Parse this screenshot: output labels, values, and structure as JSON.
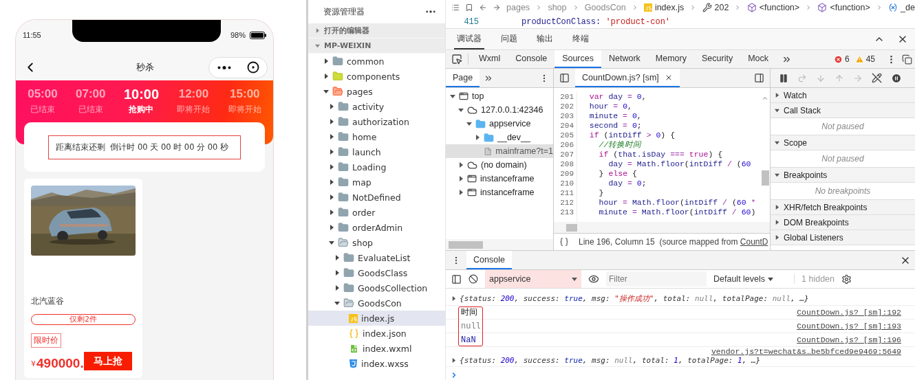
{
  "phone": {
    "status_time": "11:55",
    "battery": "98%",
    "title": "秒杀",
    "slots": [
      {
        "time": "05:00",
        "label": "已结束",
        "selected": false
      },
      {
        "time": "07:00",
        "label": "已结束",
        "selected": false
      },
      {
        "time": "10:00",
        "label": "抢购中",
        "selected": true
      },
      {
        "time": "12:00",
        "label": "即将开始",
        "selected": false
      },
      {
        "time": "15:00",
        "label": "即将开始",
        "selected": false
      }
    ],
    "countdown": "距离结束还剩  倒计时 00 天 00 时 00 分 00 秒",
    "products": [
      {
        "name": "北汽蓝谷",
        "stock": "仅剩2件",
        "tag": "限时价",
        "currency": "¥",
        "price": "490000.",
        "button": "马上抢"
      }
    ]
  },
  "explorer": {
    "title": "资源管理器",
    "sections": [
      {
        "label": "打开的编辑器",
        "expanded": false
      },
      {
        "label": "MP-WEIXIN",
        "expanded": true
      }
    ],
    "tree": [
      {
        "label": "common",
        "kind": "folder",
        "expanded": false,
        "selected": false
      },
      {
        "label": "components",
        "kind": "lib",
        "expanded": false,
        "selected": false
      },
      {
        "label": "pages",
        "kind": "pages",
        "expanded": true,
        "selected": false,
        "children": [
          {
            "label": "activity",
            "kind": "folder",
            "expanded": false,
            "selected": false
          },
          {
            "label": "authorization",
            "kind": "folder",
            "expanded": false,
            "selected": false
          },
          {
            "label": "home",
            "kind": "folder",
            "expanded": false,
            "selected": false
          },
          {
            "label": "launch",
            "kind": "folder",
            "expanded": false,
            "selected": false
          },
          {
            "label": "Loading",
            "kind": "folder",
            "expanded": false,
            "selected": false
          },
          {
            "label": "map",
            "kind": "folder",
            "expanded": false,
            "selected": false
          },
          {
            "label": "NotDefined",
            "kind": "folder",
            "expanded": false,
            "selected": false
          },
          {
            "label": "order",
            "kind": "folder",
            "expanded": false,
            "selected": false
          },
          {
            "label": "orderAdmin",
            "kind": "folder",
            "expanded": false,
            "selected": false
          },
          {
            "label": "shop",
            "kind": "folder",
            "expanded": true,
            "selected": false,
            "children": [
              {
                "label": "EvaluateList",
                "kind": "folder",
                "expanded": false,
                "selected": false
              },
              {
                "label": "GoodsClass",
                "kind": "folder",
                "expanded": false,
                "selected": false
              },
              {
                "label": "GoodsCollection",
                "kind": "folder",
                "expanded": false,
                "selected": false
              },
              {
                "label": "GoodsCon",
                "kind": "folder",
                "expanded": true,
                "selected": false,
                "children": [
                  {
                    "label": "index.js",
                    "kind": "js",
                    "selected": true
                  },
                  {
                    "label": "index.json",
                    "kind": "json",
                    "selected": false
                  },
                  {
                    "label": "index.wxml",
                    "kind": "wxml",
                    "selected": false
                  },
                  {
                    "label": "index.wxss",
                    "kind": "wxss",
                    "selected": false
                  }
                ]
              }
            ]
          }
        ]
      }
    ]
  },
  "breadcrumb": [
    {
      "label": "pages",
      "kind": "text"
    },
    {
      "label": "shop",
      "kind": "text"
    },
    {
      "label": "GoodsCon",
      "kind": "text"
    },
    {
      "label": "index.js",
      "kind": "js"
    },
    {
      "label": "202",
      "kind": "wrench"
    },
    {
      "label": "<function>",
      "kind": "cube"
    },
    {
      "label": "<function>",
      "kind": "cube"
    },
    {
      "label": "_de",
      "kind": "variable"
    }
  ],
  "peek_line": {
    "number": "415",
    "tokens": [
      {
        "text": "productConClass: ",
        "kind": "id"
      },
      {
        "text": "'product-con'",
        "kind": "str"
      }
    ]
  },
  "panel_tabs": [
    {
      "label": "调试器",
      "selected": true
    },
    {
      "label": "问题",
      "selected": false
    },
    {
      "label": "输出",
      "selected": false
    },
    {
      "label": "终端",
      "selected": false
    }
  ],
  "tool_tabs": [
    {
      "label": "Wxml",
      "selected": false
    },
    {
      "label": "Console",
      "selected": false
    },
    {
      "label": "Sources",
      "selected": true
    },
    {
      "label": "Network",
      "selected": false
    },
    {
      "label": "Memory",
      "selected": false
    },
    {
      "label": "Security",
      "selected": false
    },
    {
      "label": "Mock",
      "selected": false
    }
  ],
  "errors": "6",
  "warnings": "45",
  "navigator": {
    "tab": "Page",
    "tree": [
      {
        "label": "top",
        "kind": "frame",
        "expanded": true,
        "selected": false,
        "children": [
          {
            "label": "127.0.0.1:42346",
            "kind": "cloud",
            "expanded": true,
            "selected": false,
            "children": [
              {
                "label": "appservice",
                "kind": "folder",
                "expanded": true,
                "selected": false,
                "children": [
                  {
                    "label": "__dev__",
                    "kind": "folder",
                    "expanded": false,
                    "selected": false
                  },
                  {
                    "label": "mainframe?t=1",
                    "kind": "file",
                    "selected": true
                  }
                ]
              }
            ]
          },
          {
            "label": "(no domain)",
            "kind": "cloud",
            "expanded": false,
            "selected": false
          },
          {
            "label": "instanceframe",
            "kind": "frame",
            "expanded": false,
            "selected": false
          },
          {
            "label": "instanceframe",
            "kind": "frame",
            "expanded": false,
            "selected": false
          }
        ]
      }
    ]
  },
  "editor": {
    "tab": "CountDown.js? [sm]",
    "lines": [
      {
        "n": "201",
        "tokens": [
          {
            "text": "  var ",
            "kind": "kw"
          },
          {
            "text": "day",
            "kind": "id"
          },
          {
            "text": " = ",
            "kind": "op"
          },
          {
            "text": "0",
            "kind": "num"
          },
          {
            "text": ",",
            "kind": "pl"
          }
        ]
      },
      {
        "n": "202",
        "tokens": [
          {
            "text": "  hour",
            "kind": "id"
          },
          {
            "text": " = ",
            "kind": "op"
          },
          {
            "text": "0",
            "kind": "num"
          },
          {
            "text": ",",
            "kind": "pl"
          }
        ]
      },
      {
        "n": "203",
        "tokens": [
          {
            "text": "  minute",
            "kind": "id"
          },
          {
            "text": " = ",
            "kind": "op"
          },
          {
            "text": "0",
            "kind": "num"
          },
          {
            "text": ",",
            "kind": "pl"
          }
        ]
      },
      {
        "n": "204",
        "tokens": [
          {
            "text": "  second",
            "kind": "id"
          },
          {
            "text": " = ",
            "kind": "op"
          },
          {
            "text": "0",
            "kind": "num"
          },
          {
            "text": ";",
            "kind": "pl"
          }
        ]
      },
      {
        "n": "205",
        "tokens": [
          {
            "text": "  if",
            "kind": "kw"
          },
          {
            "text": " (",
            "kind": "pl"
          },
          {
            "text": "intDiff",
            "kind": "id"
          },
          {
            "text": " > ",
            "kind": "op"
          },
          {
            "text": "0",
            "kind": "num"
          },
          {
            "text": ") {",
            "kind": "pl"
          }
        ]
      },
      {
        "n": "206",
        "tokens": [
          {
            "text": "    //转换时间",
            "kind": "cmt"
          }
        ]
      },
      {
        "n": "207",
        "tokens": [
          {
            "text": "    if",
            "kind": "kw"
          },
          {
            "text": " (",
            "kind": "pl"
          },
          {
            "text": "that.isDay",
            "kind": "id"
          },
          {
            "text": " === ",
            "kind": "op"
          },
          {
            "text": "true",
            "kind": "kw"
          },
          {
            "text": ") {",
            "kind": "pl"
          }
        ]
      },
      {
        "n": "208",
        "tokens": [
          {
            "text": "      day",
            "kind": "id"
          },
          {
            "text": " = ",
            "kind": "op"
          },
          {
            "text": "Math.floor",
            "kind": "id"
          },
          {
            "text": "(",
            "kind": "pl"
          },
          {
            "text": "intDiff",
            "kind": "id"
          },
          {
            "text": " / ",
            "kind": "op"
          },
          {
            "text": "(",
            "kind": "pl"
          },
          {
            "text": "60",
            "kind": "num"
          }
        ]
      },
      {
        "n": "209",
        "tokens": [
          {
            "text": "    } ",
            "kind": "pl"
          },
          {
            "text": "else",
            "kind": "kw"
          },
          {
            "text": " {",
            "kind": "pl"
          }
        ]
      },
      {
        "n": "210",
        "tokens": [
          {
            "text": "      day",
            "kind": "id"
          },
          {
            "text": " = ",
            "kind": "op"
          },
          {
            "text": "0",
            "kind": "num"
          },
          {
            "text": ";",
            "kind": "pl"
          }
        ]
      },
      {
        "n": "211",
        "tokens": [
          {
            "text": "    }",
            "kind": "pl"
          }
        ]
      },
      {
        "n": "212",
        "tokens": [
          {
            "text": "    hour",
            "kind": "id"
          },
          {
            "text": " = ",
            "kind": "op"
          },
          {
            "text": "Math.floor",
            "kind": "id"
          },
          {
            "text": "(",
            "kind": "pl"
          },
          {
            "text": "intDiff",
            "kind": "id"
          },
          {
            "text": " / ",
            "kind": "op"
          },
          {
            "text": "(",
            "kind": "pl"
          },
          {
            "text": "60",
            "kind": "num"
          },
          {
            "text": " *",
            "kind": "op"
          }
        ]
      },
      {
        "n": "213",
        "tokens": [
          {
            "text": "    minute",
            "kind": "id"
          },
          {
            "text": " = ",
            "kind": "op"
          },
          {
            "text": "Math.floor",
            "kind": "id"
          },
          {
            "text": "(",
            "kind": "pl"
          },
          {
            "text": "intDiff",
            "kind": "id"
          },
          {
            "text": " / ",
            "kind": "op"
          },
          {
            "text": "60",
            "kind": "num"
          },
          {
            "text": ")",
            "kind": "pl"
          }
        ]
      }
    ],
    "status": "Line 196, Column 15  (source mapped from ",
    "status_link": "CountD"
  },
  "debugger": [
    {
      "label": "Watch",
      "expanded": false
    },
    {
      "label": "Call Stack",
      "expanded": true,
      "content": "Not paused"
    },
    {
      "label": "Scope",
      "expanded": true,
      "content": "Not paused"
    },
    {
      "label": "Breakpoints",
      "expanded": true,
      "content": "No breakpoints"
    },
    {
      "label": "XHR/fetch Breakpoints",
      "expanded": false
    },
    {
      "label": "DOM Breakpoints",
      "expanded": false
    },
    {
      "label": "Global Listeners",
      "expanded": false
    }
  ],
  "console": {
    "tab": "Console",
    "context": "appservice",
    "filter_placeholder": "Filter",
    "levels": "Default levels",
    "hidden": "1 hidden",
    "messages": [
      {
        "kind": "object",
        "highlighted": false,
        "tokens": [
          {
            "text": "{",
            "kind": "pl"
          },
          {
            "text": "status",
            "kind": "key"
          },
          {
            "text": ": ",
            "kind": "pl"
          },
          {
            "text": "200",
            "kind": "num"
          },
          {
            "text": ", ",
            "kind": "pl"
          },
          {
            "text": "success",
            "kind": "key"
          },
          {
            "text": ": ",
            "kind": "pl"
          },
          {
            "text": "true",
            "kind": "bool"
          },
          {
            "text": ", ",
            "kind": "pl"
          },
          {
            "text": "msg",
            "kind": "key"
          },
          {
            "text": ": ",
            "kind": "pl"
          },
          {
            "text": "\"操作成功\"",
            "kind": "str"
          },
          {
            "text": ", ",
            "kind": "pl"
          },
          {
            "text": "total",
            "kind": "key"
          },
          {
            "text": ": ",
            "kind": "pl"
          },
          {
            "text": "null",
            "kind": "nul"
          },
          {
            "text": ", ",
            "kind": "pl"
          },
          {
            "text": "totalPage",
            "kind": "key"
          },
          {
            "text": ": ",
            "kind": "pl"
          },
          {
            "text": "null",
            "kind": "nul"
          },
          {
            "text": ", …}",
            "kind": "pl"
          }
        ]
      },
      {
        "kind": "text",
        "highlighted": true,
        "text": "时间",
        "source": "CountDown.js? [sm]:192"
      },
      {
        "kind": "null",
        "highlighted": true,
        "text": "null",
        "source": "CountDown.js? [sm]:193"
      },
      {
        "kind": "number",
        "highlighted": true,
        "text": "NaN",
        "source": "CountDown.js? [sm]:196"
      },
      {
        "kind": "object",
        "highlighted": false,
        "source": "vendor.js?t=wechat&s…be5bfced9e9469:5649",
        "tokens": [
          {
            "text": "{",
            "kind": "pl"
          },
          {
            "text": "status",
            "kind": "key"
          },
          {
            "text": ": ",
            "kind": "pl"
          },
          {
            "text": "200",
            "kind": "num"
          },
          {
            "text": ", ",
            "kind": "pl"
          },
          {
            "text": "success",
            "kind": "key"
          },
          {
            "text": ": ",
            "kind": "pl"
          },
          {
            "text": "true",
            "kind": "bool"
          },
          {
            "text": ", ",
            "kind": "pl"
          },
          {
            "text": "msg",
            "kind": "key"
          },
          {
            "text": ": ",
            "kind": "pl"
          },
          {
            "text": "null",
            "kind": "nul"
          },
          {
            "text": ", ",
            "kind": "pl"
          },
          {
            "text": "total",
            "kind": "key"
          },
          {
            "text": ": ",
            "kind": "pl"
          },
          {
            "text": "1",
            "kind": "num"
          },
          {
            "text": ", ",
            "kind": "pl"
          },
          {
            "text": "totalPage",
            "kind": "key"
          },
          {
            "text": ": ",
            "kind": "pl"
          },
          {
            "text": "1",
            "kind": "num"
          },
          {
            "text": ", …}",
            "kind": "pl"
          }
        ]
      }
    ]
  }
}
